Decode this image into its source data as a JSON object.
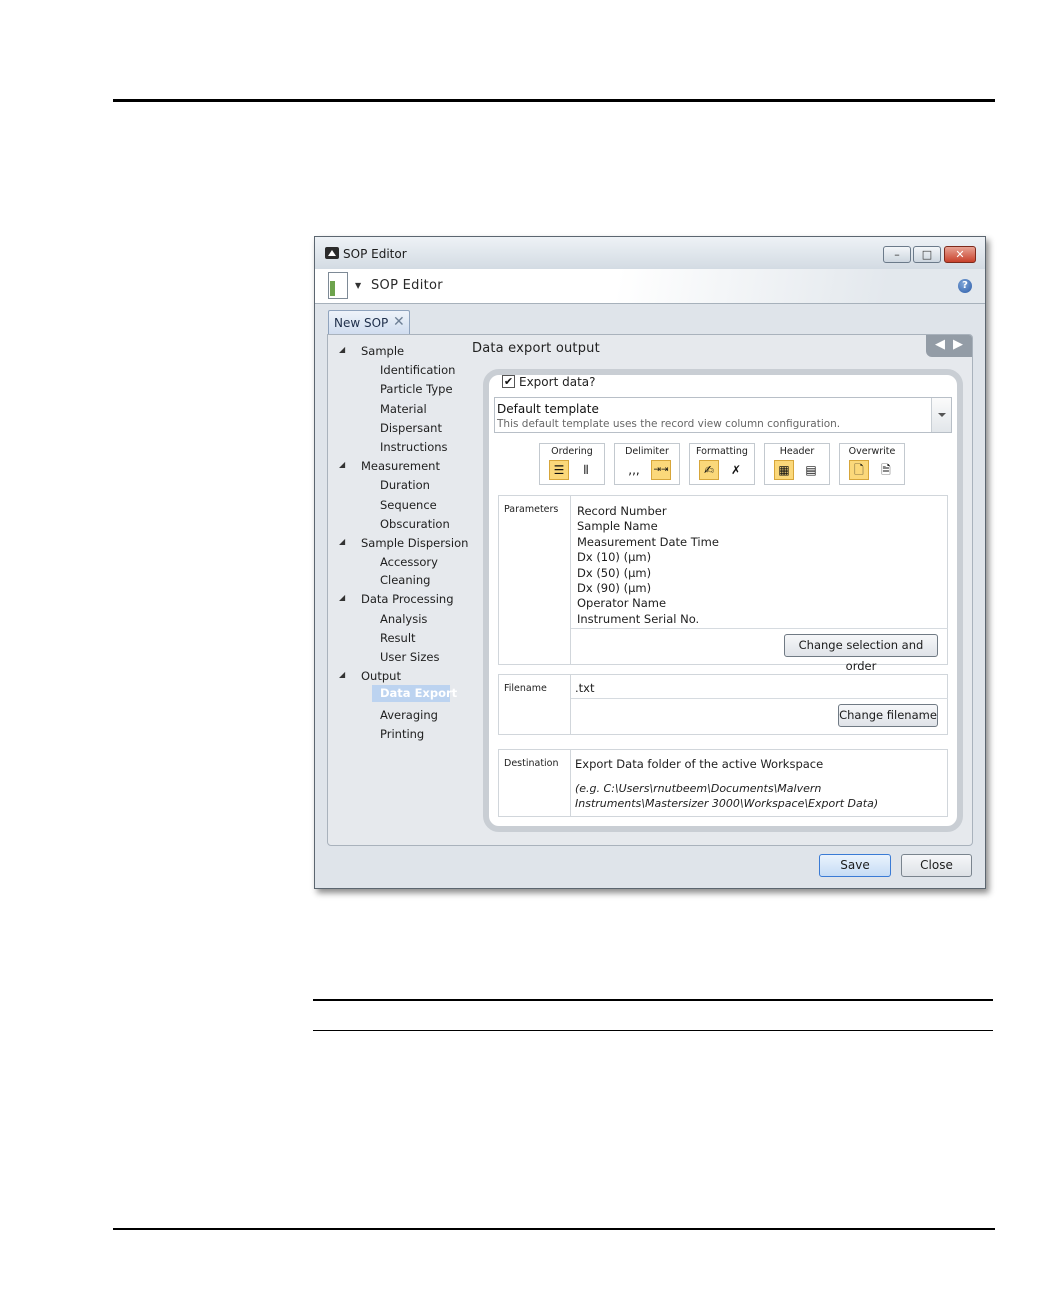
{
  "window": {
    "title": "SOP Editor",
    "header_title": "SOP Editor",
    "help": "?",
    "close_glyph": "✕",
    "min_glyph": "–",
    "max_glyph": "□"
  },
  "tab": {
    "label": "New SOP",
    "close_glyph": "✕"
  },
  "nav": {
    "sample": "Sample",
    "identification": "Identification",
    "particle_type": "Particle Type",
    "material": "Material",
    "dispersant": "Dispersant",
    "instructions": "Instructions",
    "measurement": "Measurement",
    "duration": "Duration",
    "sequence": "Sequence",
    "obscuration": "Obscuration",
    "sample_dispersion": "Sample Dispersion",
    "accessory": "Accessory",
    "cleaning": "Cleaning",
    "data_processing": "Data Processing",
    "analysis": "Analysis",
    "result": "Result",
    "user_sizes": "User Sizes",
    "output": "Output",
    "data_export": "Data Export",
    "averaging": "Averaging",
    "printing": "Printing"
  },
  "panel": {
    "title": "Data export output",
    "arrow_left": "◀",
    "arrow_right": "▶",
    "export_label": "Export data?",
    "export_checked": "✔",
    "template_name": "Default template",
    "template_desc": "This default template uses the record view column configuration."
  },
  "options": {
    "ordering": "Ordering",
    "delimiter": "Delimiter",
    "formatting": "Formatting",
    "header": "Header",
    "overwrite": "Overwrite"
  },
  "parameters": {
    "label": "Parameters",
    "items": [
      "Record Number",
      "Sample Name",
      "Measurement Date Time",
      "Dx (10) (µm)",
      "Dx (50) (µm)",
      "Dx (90) (µm)",
      "Operator Name",
      "Instrument Serial No."
    ],
    "change_button": "Change selection and order"
  },
  "filename": {
    "label": "Filename",
    "value": ".txt",
    "change_button": "Change filename"
  },
  "destination": {
    "label": "Destination",
    "line1": "Export Data folder of the active Workspace",
    "line2": "(e.g. C:\\Users\\rnutbeem\\Documents\\Malvern Instruments\\Mastersizer 3000\\Workspace\\Export Data)"
  },
  "footer": {
    "save": "Save",
    "close": "Close"
  }
}
